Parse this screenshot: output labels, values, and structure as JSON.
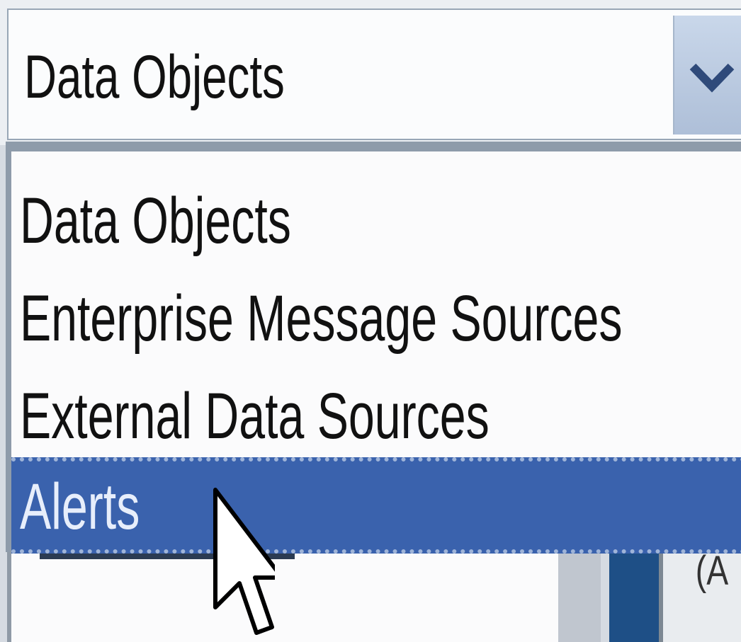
{
  "combo": {
    "selected_value": "Data Objects",
    "arrow_icon": "chevron-down-icon"
  },
  "dropdown": {
    "options": [
      {
        "label": "Data Objects",
        "highlighted": false
      },
      {
        "label": "Enterprise Message Sources",
        "highlighted": false
      },
      {
        "label": "External Data Sources",
        "highlighted": false
      },
      {
        "label": "Alerts",
        "highlighted": true
      }
    ]
  },
  "background": {
    "partial_text": "(A"
  },
  "colors": {
    "highlight": "#3a62ad",
    "arrow_button": "#b9c9df",
    "border": "#8e9baa"
  },
  "cursor_icon": "arrow-pointer-icon"
}
